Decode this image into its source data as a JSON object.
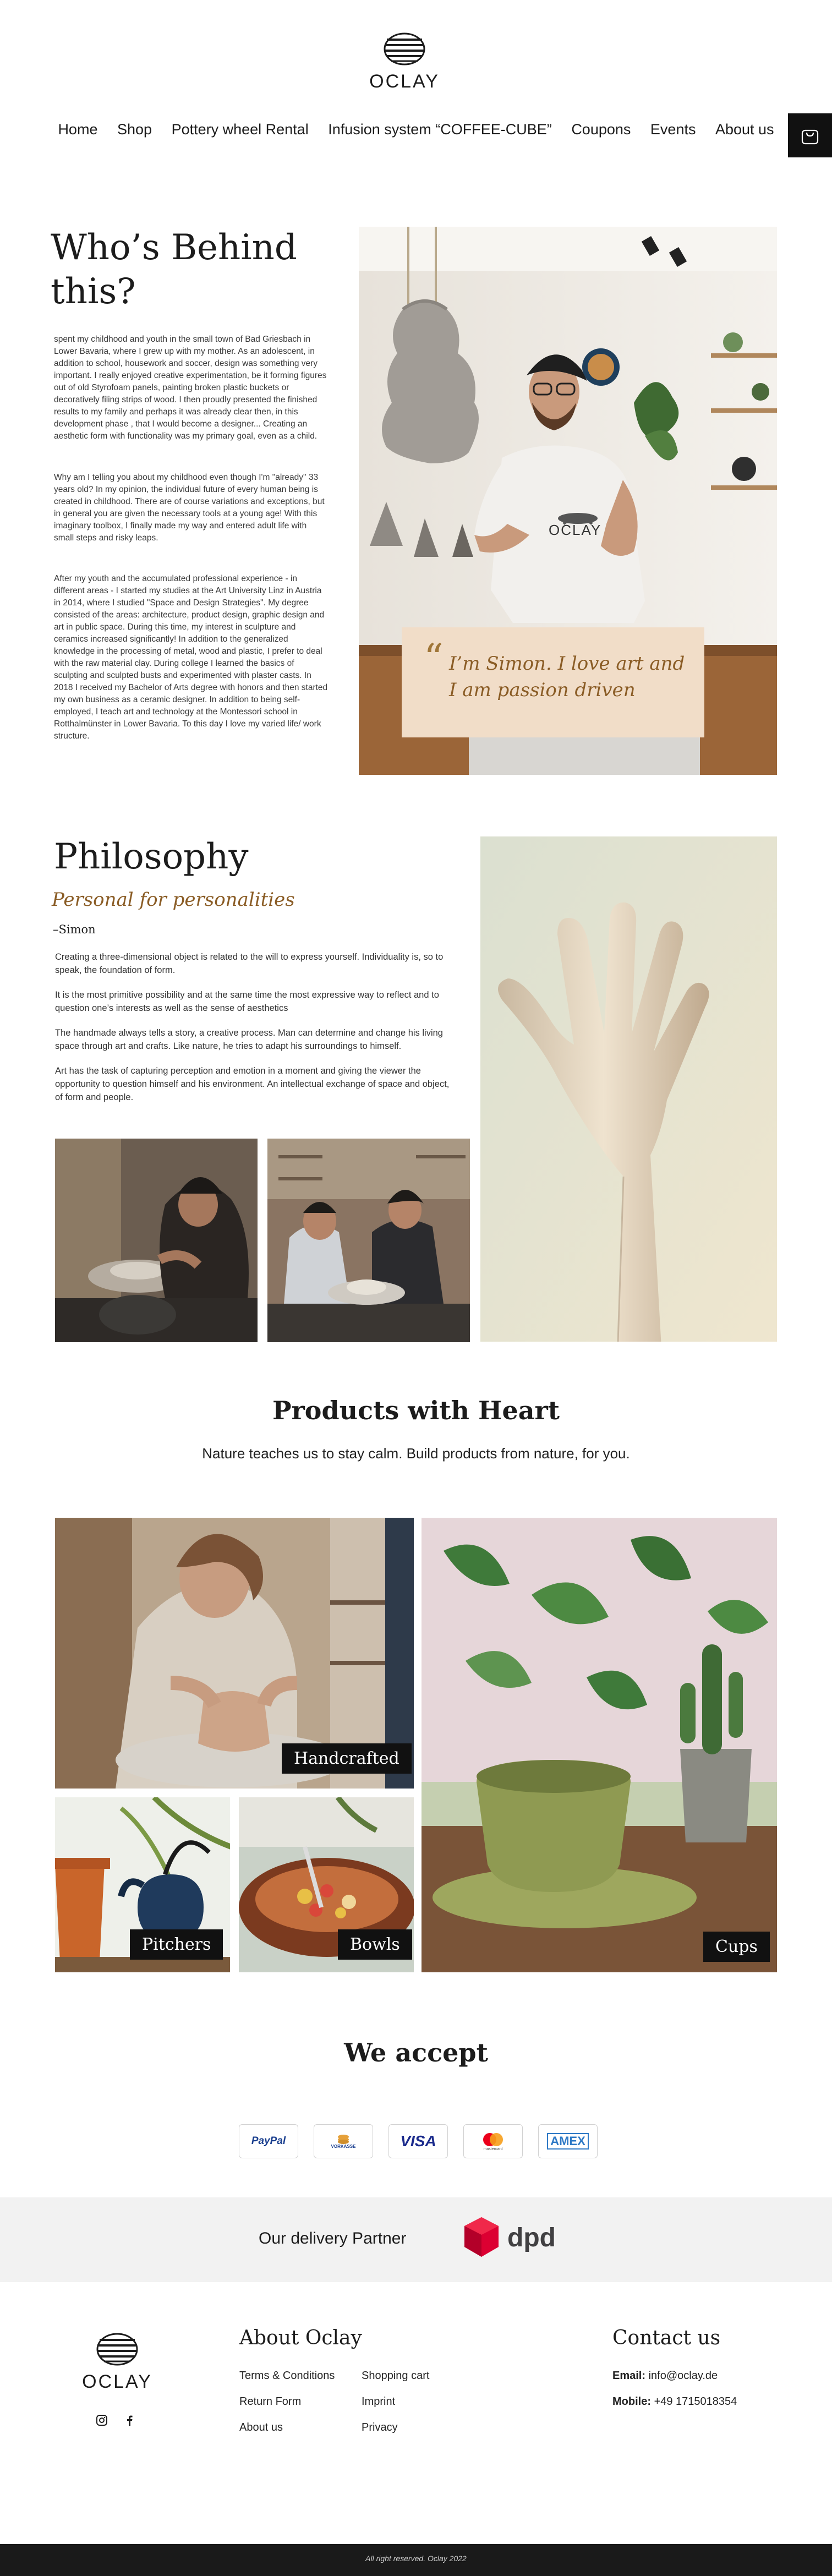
{
  "brand": {
    "name": "OCLAY"
  },
  "nav": {
    "items": [
      "Home",
      "Shop",
      "Pottery wheel Rental",
      "Infusion system “COFFEE-CUBE”",
      "Coupons",
      "Events",
      "About us"
    ],
    "cart_icon": "shopping-bag-icon"
  },
  "about": {
    "title": "Who’s Behind this?",
    "paragraphs": [
      "spent my childhood and youth in the small town of Bad Griesbach in Lower Bavaria, where I grew up with my mother. As an adolescent, in addition to school, housework and soccer, design was something very important. I really enjoyed creative experimentation, be it forming figures out of old Styrofoam panels, painting broken plastic buckets or decoratively filing strips of wood. I then proudly presented the finished results to my family and perhaps it was already clear then, in this development phase , that I would become a designer... Creating an aesthetic form with functionality was my primary goal, even as a child.",
      "Why am I telling you about my childhood even though I'm \"already\" 33 years old? In my opinion, the individual future of every human being is created in childhood. There are of course variations and exceptions, but in general you are given the necessary tools at a young age! With this imaginary toolbox, I finally made my way and entered adult life with small steps and risky leaps.",
      "After my youth and the accumulated professional experience - in different areas - I started my studies at the Art University Linz in Austria in 2014, where I studied \"Space and Design Strategies\". My degree consisted of the areas: architecture, product design, graphic design and art in public space. During this time, my interest in sculpture and ceramics increased significantly! In addition to the generalized knowledge in the processing of metal, wood and plastic, I prefer to deal with the raw material clay. During college I learned the basics of sculpting and sculpted busts and experimented with plaster casts. In 2018 I received my Bachelor of Arts degree with honors and then started my own business as a ceramic designer. In addition to being self-employed, I teach art and technology at the Montessori school in Rotthalmünster in Lower Bavaria. To this day I love my varied life/ work structure."
    ],
    "quote_mark": "“",
    "quote": "I’m Simon. I love art and I am passion driven"
  },
  "philosophy": {
    "title": "Philosophy",
    "subtitle": "Personal for personalities",
    "signature": "–Simon",
    "paragraphs": [
      "Creating a three-dimensional object is related to the will to express yourself. Individuality is, so to speak, the foundation of form.",
      "It is the most primitive possibility and at the same time the most expressive way to reflect and to question one’s interests as well as the sense of aesthetics",
      "The handmade always tells a story, a creative process. Man can determine and change his living space through art and crafts. Like nature, he tries to adapt his surroundings to himself.",
      "Art has the task of capturing perception and emotion in a moment and giving the viewer the opportunity to question himself and his environment. An intellectual exchange of space and object, of form and people."
    ]
  },
  "products": {
    "title": "Products with Heart",
    "subtitle": "Nature teaches us to stay calm. Build products from nature, for you.",
    "tiles": [
      {
        "label": "Handcrafted"
      },
      {
        "label": "Pitchers"
      },
      {
        "label": "Bowls"
      },
      {
        "label": "Cups"
      }
    ]
  },
  "payments": {
    "title": "We accept",
    "methods": [
      {
        "name": "PayPal",
        "text": "PayPal",
        "color": "#1a3f8f"
      },
      {
        "name": "Vorkasse",
        "text": "VORKASSE",
        "color": "#e6a13a"
      },
      {
        "name": "Visa",
        "text": "VISA",
        "color": "#1a2a8c"
      },
      {
        "name": "Mastercard",
        "text": "mastercard",
        "color": "#eb001b"
      },
      {
        "name": "Amex",
        "text": "AMEX",
        "color": "#2f7ac6"
      }
    ]
  },
  "delivery": {
    "text": "Our delivery Partner",
    "partner": "dpd",
    "partner_color": "#dc0032"
  },
  "footer": {
    "about_title": "About Oclay",
    "links_col1": [
      "Terms & Conditions",
      "Return Form",
      "About us"
    ],
    "links_col2": [
      "Shopping cart",
      "Imprint",
      "Privacy"
    ],
    "contact_title": "Contact us",
    "email_label": "Email:",
    "email": "info@oclay.de",
    "mobile_label": "Mobile:",
    "mobile": "+49 1715018354",
    "copyright": "All right reserved. Oclay 2022"
  }
}
